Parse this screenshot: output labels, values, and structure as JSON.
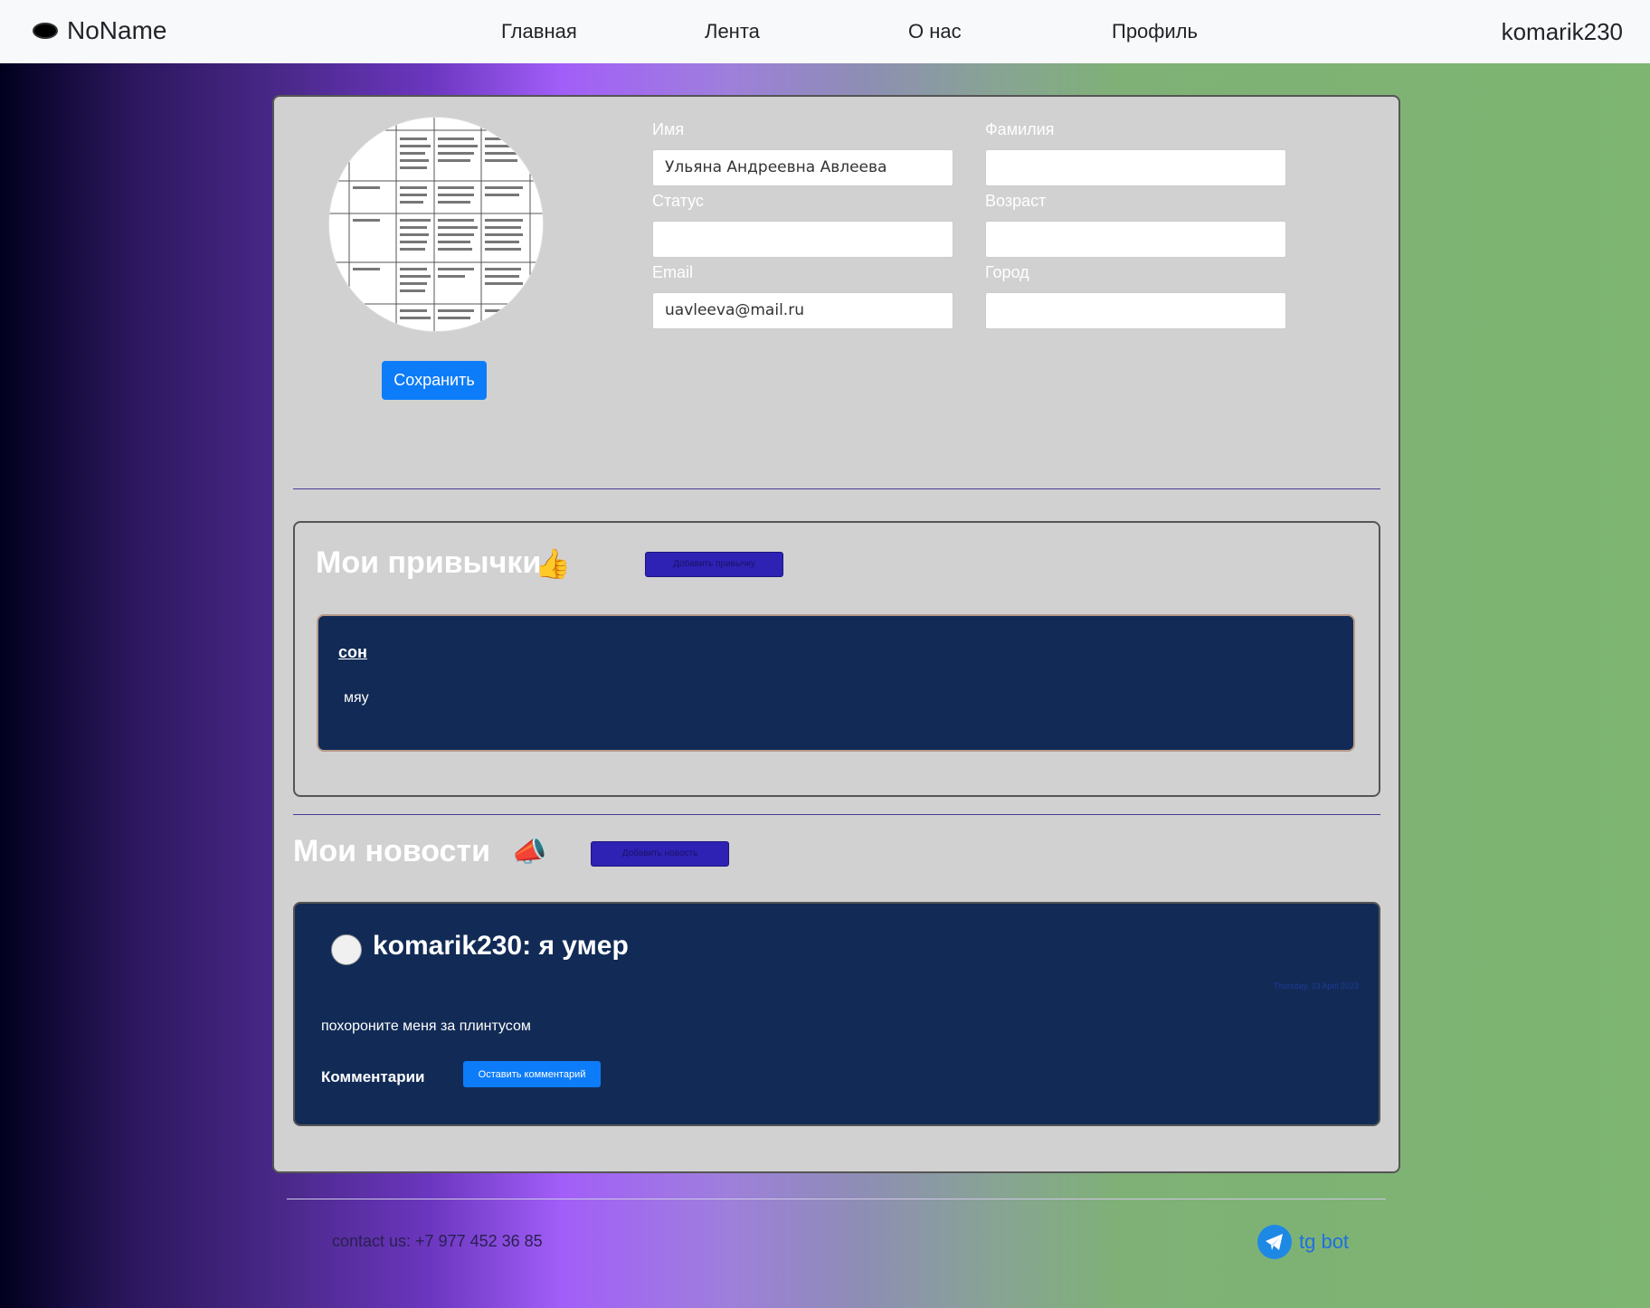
{
  "navbar": {
    "brand": "NoName",
    "links": [
      "Главная",
      "Лента",
      "О нас",
      "Профиль"
    ],
    "user": "komarik230"
  },
  "profile": {
    "labels": {
      "name": "Имя",
      "surname": "Фамилия",
      "status": "Статус",
      "age": "Возраст",
      "email": "Email",
      "city": "Город"
    },
    "values": {
      "name": "Ульяна Андреевна Авлеева",
      "surname": "",
      "status": "",
      "age": "",
      "email": "uavleeva@mail.ru",
      "city": ""
    },
    "save_label": "Сохранить"
  },
  "habits": {
    "title": "Мои привычки",
    "emoji": "👍",
    "add_label": "Добавить привычку",
    "items": [
      {
        "title": "сон",
        "text": "мяу"
      }
    ]
  },
  "news": {
    "title": "Мои новости",
    "emoji": "📣",
    "add_label": "Добавить новость",
    "items": [
      {
        "title": "komarik230: я умер",
        "date": "Thursday, 13 April 2023",
        "text": "похороните меня за плинтусом",
        "comments_label": "Комментарии",
        "comment_button": "Оставить комментарий"
      }
    ]
  },
  "footer": {
    "contact": "contact us: +7 977 452 36 85",
    "tg": "tg bot"
  },
  "colors": {
    "accent": "#0d7cf8",
    "card_dark": "#122b56",
    "panel": "#d1d1d1"
  }
}
